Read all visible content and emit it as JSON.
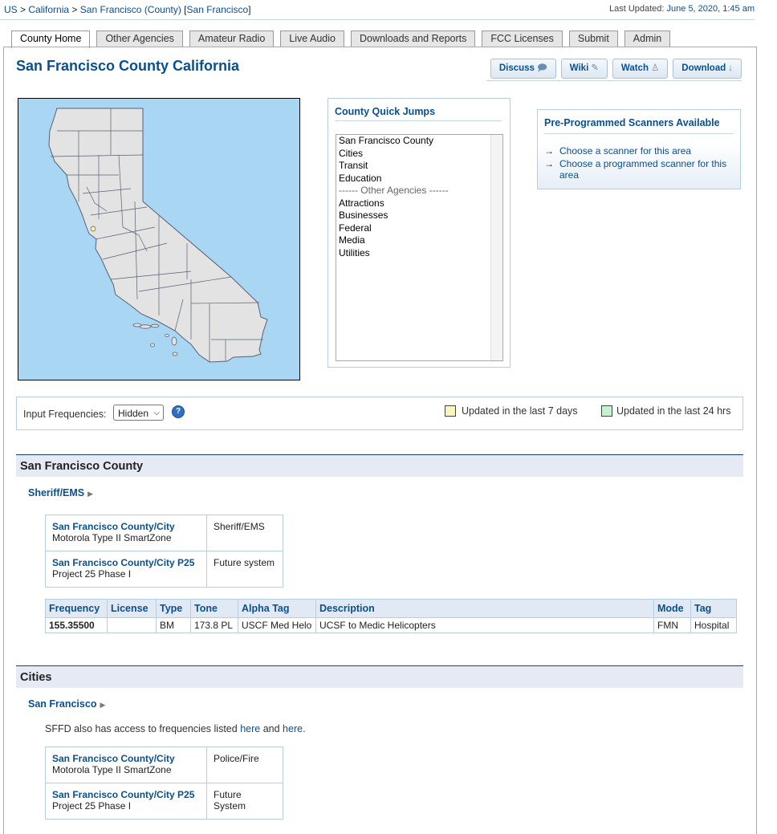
{
  "breadcrumb": {
    "us": "US",
    "sep1": ">",
    "state": "California",
    "sep2": ">",
    "county": "San Francisco (County)",
    "bracket_open": "[",
    "city": "San Francisco",
    "bracket_close": "]"
  },
  "last_updated": {
    "label": "Last Updated:",
    "value": "June 5, 2020, 1:45 am"
  },
  "tabs": [
    {
      "label": "County Home",
      "active": true
    },
    {
      "label": "Other Agencies"
    },
    {
      "label": "Amateur Radio"
    },
    {
      "label": "Live Audio"
    },
    {
      "label": "Downloads and Reports"
    },
    {
      "label": "FCC Licenses"
    },
    {
      "label": "Submit"
    },
    {
      "label": "Admin"
    }
  ],
  "page_title": "San Francisco County California",
  "actions": [
    {
      "label": "Discuss",
      "icon": "chat-icon",
      "glyph": "🗩"
    },
    {
      "label": "Wiki",
      "icon": "pencil-icon",
      "glyph": "✎"
    },
    {
      "label": "Watch",
      "icon": "person-icon",
      "glyph": "♙"
    },
    {
      "label": "Download",
      "icon": "arrow-down-icon",
      "glyph": "↓"
    }
  ],
  "map": {
    "ocean_color": "#a9d7f3",
    "land_color": "#e3e3e3",
    "highlight_color": "#f7f3a0"
  },
  "quick_jumps": {
    "title": "County Quick Jumps",
    "options": [
      "San Francisco County",
      "Cities",
      "Transit",
      "Education",
      "------ Other Agencies ------",
      "Attractions",
      "Businesses",
      "Federal",
      "Media",
      "Utilities"
    ]
  },
  "scanners": {
    "title": "Pre-Programmed Scanners Available",
    "arrow": "→",
    "links": [
      "Choose a scanner for this area",
      "Choose a programmed scanner for this area"
    ]
  },
  "filter": {
    "label": "Input Frequencies:",
    "selected": "Hidden",
    "help": "?",
    "legend_7days": "Updated in the last 7 days",
    "legend_24hrs": "Updated in the last 24 hrs",
    "color_7days": "#fbf6c0",
    "color_24hrs": "#c6f2cf"
  },
  "sections": {
    "county": {
      "title": "San Francisco County",
      "sub": "Sheriff/EMS",
      "systems": [
        {
          "name": "San Francisco County/City",
          "type": "Motorola Type II SmartZone",
          "use": "Sheriff/EMS"
        },
        {
          "name": "San Francisco County/City P25",
          "type": "Project 25 Phase I",
          "use": "Future system"
        }
      ],
      "freq_headers": [
        "Frequency",
        "License",
        "Type",
        "Tone",
        "Alpha Tag",
        "Description",
        "Mode",
        "Tag"
      ],
      "freq_rows": [
        {
          "frequency": "155.35500",
          "license": "",
          "type": "BM",
          "tone": "173.8 PL",
          "alpha": "USCF Med Helo",
          "description": "UCSF to Medic Helicopters",
          "mode": "FMN",
          "tag": "Hospital"
        }
      ]
    },
    "cities": {
      "title": "Cities",
      "sub": "San Francisco",
      "note_pre": "SFFD also has access to frequencies listed",
      "note_link1": "here",
      "note_and": "and",
      "note_link2": "here",
      "note_end": ".",
      "systems": [
        {
          "name": "San Francisco County/City",
          "type": "Motorola Type II SmartZone",
          "use": "Police/Fire"
        },
        {
          "name": "San Francisco County/City P25",
          "type": "Project 25 Phase I",
          "use": "Future System"
        }
      ]
    }
  }
}
